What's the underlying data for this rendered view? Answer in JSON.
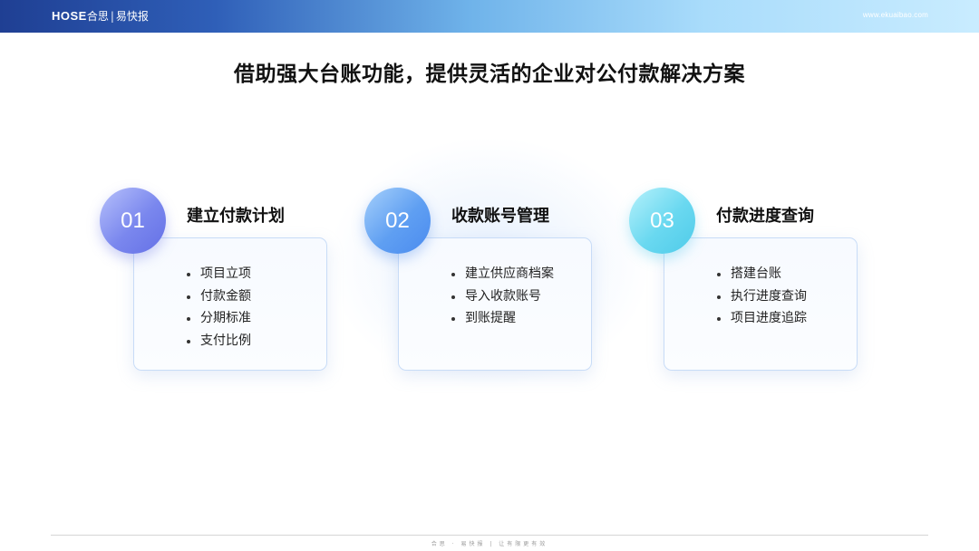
{
  "header": {
    "logo_brand": "HOSE",
    "logo_company": "合思",
    "logo_separator": "|",
    "logo_product": "易快报",
    "url": "www.ekuaibao.com"
  },
  "title": "借助强大台账功能，提供灵活的企业对公付款解决方案",
  "steps": [
    {
      "number": "01",
      "title": "建立付款计划",
      "items": [
        "项目立项",
        "付款金额",
        "分期标准",
        "支付比例"
      ]
    },
    {
      "number": "02",
      "title": "收款账号管理",
      "items": [
        "建立供应商档案",
        "导入收款账号",
        "到账提醒"
      ]
    },
    {
      "number": "03",
      "title": "付款进度查询",
      "items": [
        "搭建台账",
        "执行进度查询",
        "项目进度追踪"
      ]
    }
  ],
  "footer": {
    "text": "合思 · 易快报 | 让有限更有效"
  },
  "colors": {
    "step1": "#6f7ceb",
    "step2": "#5596f0",
    "step3": "#5ad0ec",
    "header_start": "#1f3f93",
    "header_end": "#c9ecff"
  }
}
